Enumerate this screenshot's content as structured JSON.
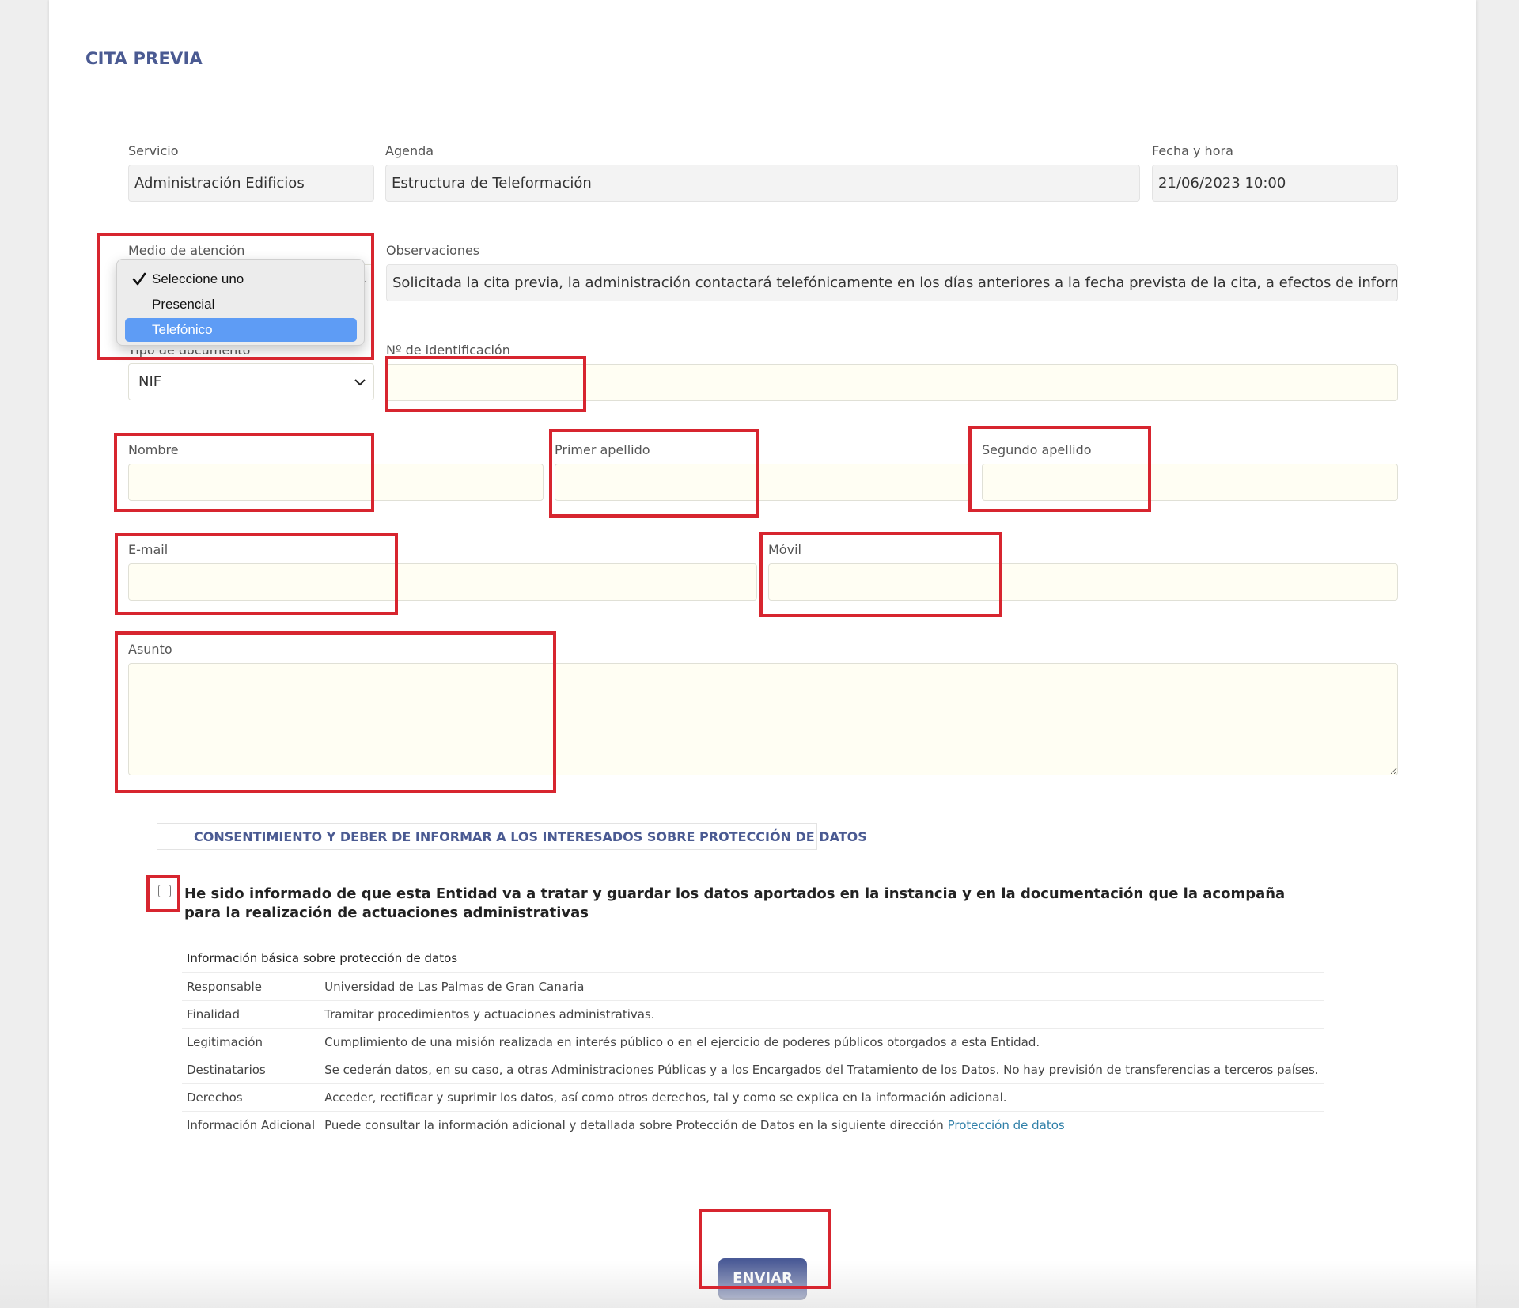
{
  "page": {
    "title": "CITA PREVIA"
  },
  "servicio": {
    "label": "Servicio",
    "value": "Administración Edificios"
  },
  "agenda": {
    "label": "Agenda",
    "value": "Estructura de Teleformación"
  },
  "fecha": {
    "label": "Fecha y hora",
    "value": "21/06/2023 10:00"
  },
  "medio": {
    "label": "Medio de atención",
    "options": [
      "Seleccione uno",
      "Presencial",
      "Telefónico"
    ],
    "checked": "Seleccione uno",
    "highlighted": "Telefónico"
  },
  "observaciones": {
    "label": "Observaciones",
    "value": "Solicitada la cita previa, la administración contactará telefónicamente en los días anteriores a la fecha prevista de la cita, a efectos de informarle o faci"
  },
  "tipo_documento": {
    "label": "Tipo de documento",
    "value": "NIF"
  },
  "identificacion": {
    "label": "Nº de identificación",
    "value": ""
  },
  "nombre": {
    "label": "Nombre",
    "value": ""
  },
  "primer_apellido": {
    "label": "Primer apellido",
    "value": ""
  },
  "segundo_apellido": {
    "label": "Segundo apellido",
    "value": ""
  },
  "email": {
    "label": "E-mail",
    "value": ""
  },
  "movil": {
    "label": "Móvil",
    "value": ""
  },
  "asunto": {
    "label": "Asunto",
    "value": ""
  },
  "consent": {
    "header": "CONSENTIMIENTO Y DEBER DE INFORMAR A LOS INTERESADOS SOBRE PROTECCIÓN DE DATOS",
    "checkbox_text": "He sido informado de que esta Entidad va a tratar y guardar los datos aportados en la instancia y en la documentación que la acompaña para la realización de actuaciones administrativas",
    "checked": false
  },
  "info": {
    "title": "Información básica sobre protección de datos",
    "rows": [
      {
        "key": "Responsable",
        "value": "Universidad de Las Palmas de Gran Canaria"
      },
      {
        "key": "Finalidad",
        "value": "Tramitar procedimientos y actuaciones administrativas."
      },
      {
        "key": "Legitimación",
        "value": "Cumplimiento de una misión realizada en interés público o en el ejercicio de poderes públicos otorgados a esta Entidad."
      },
      {
        "key": "Destinatarios",
        "value": "Se cederán datos, en su caso, a otras Administraciones Públicas y a los Encargados del Tratamiento de los Datos. No hay previsión de transferencias a terceros países."
      },
      {
        "key": "Derechos",
        "value": "Acceder, rectificar y suprimir los datos, así como otros derechos, tal y como se explica en la información adicional."
      }
    ],
    "additional": {
      "key": "Información Adicional",
      "value": "Puede consultar la información adicional y detallada sobre Protección de Datos en la siguiente dirección",
      "link": "Protección de datos"
    }
  },
  "submit": {
    "label": "ENVIAR"
  },
  "colors": {
    "accent": "#4a5a92",
    "highlight": "#d7252f",
    "input_bg": "#fffef3",
    "select_blue": "#5e9cf5"
  }
}
